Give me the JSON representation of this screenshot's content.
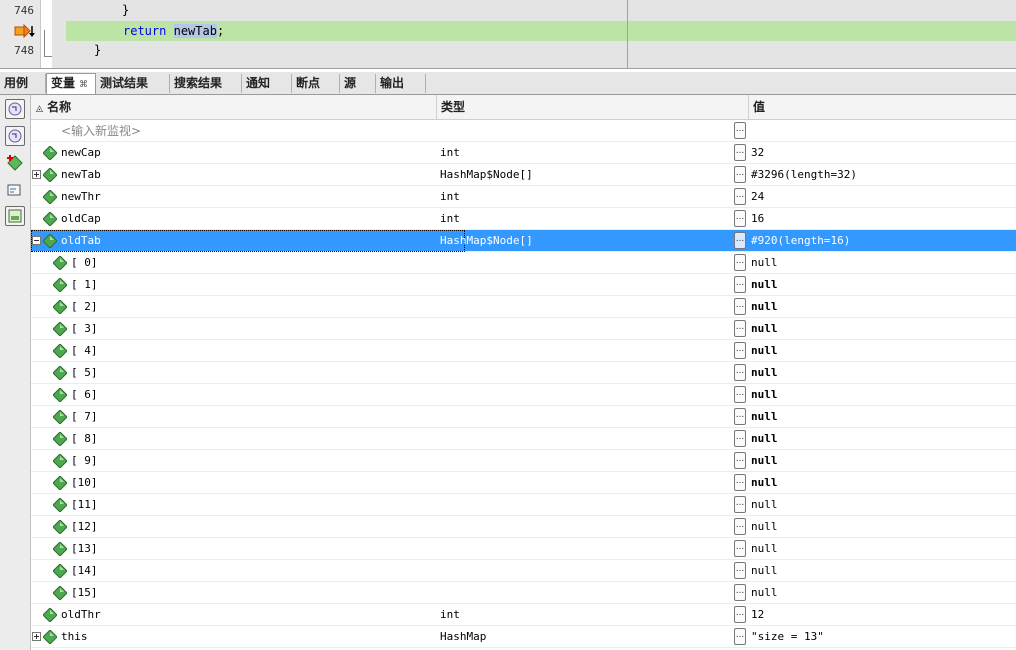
{
  "editor": {
    "lines": [
      {
        "num": "746",
        "code": "}"
      },
      {
        "num": "",
        "code_kw": "return",
        "code_ident": "newTab",
        "code_tail": ";"
      },
      {
        "num": "748",
        "code": "}"
      }
    ]
  },
  "tabs": [
    {
      "label": "用例"
    },
    {
      "label": "变量",
      "close": "⌘"
    },
    {
      "label": "测试结果"
    },
    {
      "label": "搜索结果"
    },
    {
      "label": "通知"
    },
    {
      "label": "断点"
    },
    {
      "label": "源"
    },
    {
      "label": "输出"
    }
  ],
  "table": {
    "headers": {
      "name": "名称",
      "type": "类型",
      "value": "值"
    },
    "sort_glyph": "◬",
    "watch_placeholder": "<输入新监视>",
    "ellipsis": "...",
    "rows": [
      {
        "name": "newCap",
        "type": "int",
        "value": "32"
      },
      {
        "name": "newTab",
        "type": "HashMap$Node[]",
        "value": "#3296(length=32)"
      },
      {
        "name": "newThr",
        "type": "int",
        "value": "24"
      },
      {
        "name": "oldCap",
        "type": "int",
        "value": "16"
      },
      {
        "name": "oldTab",
        "type": "HashMap$Node[]",
        "value": "#920(length=16)"
      },
      {
        "name": "[ 0]",
        "type": "",
        "value": "null"
      },
      {
        "name": "[ 1]",
        "type": "",
        "value": "null"
      },
      {
        "name": "[ 2]",
        "type": "",
        "value": "null"
      },
      {
        "name": "[ 3]",
        "type": "",
        "value": "null"
      },
      {
        "name": "[ 4]",
        "type": "",
        "value": "null"
      },
      {
        "name": "[ 5]",
        "type": "",
        "value": "null"
      },
      {
        "name": "[ 6]",
        "type": "",
        "value": "null"
      },
      {
        "name": "[ 7]",
        "type": "",
        "value": "null"
      },
      {
        "name": "[ 8]",
        "type": "",
        "value": "null"
      },
      {
        "name": "[ 9]",
        "type": "",
        "value": "null"
      },
      {
        "name": "[10]",
        "type": "",
        "value": "null"
      },
      {
        "name": "[11]",
        "type": "",
        "value": "null"
      },
      {
        "name": "[12]",
        "type": "",
        "value": "null"
      },
      {
        "name": "[13]",
        "type": "",
        "value": "null"
      },
      {
        "name": "[14]",
        "type": "",
        "value": "null"
      },
      {
        "name": "[15]",
        "type": "",
        "value": "null"
      },
      {
        "name": "oldThr",
        "type": "int",
        "value": "12"
      },
      {
        "name": "this",
        "type": "HashMap",
        "value": "\"size = 13\""
      }
    ]
  },
  "icons": {
    "variable": "green-diamond-icon",
    "current-line": "debug-arrow-icon",
    "toolbar": [
      "watch-icon",
      "watch-icon",
      "new-watch-icon",
      "expression-icon",
      "panel-icon"
    ]
  },
  "colors": {
    "selection": "#3399ff",
    "current_line": "#bde4a7",
    "gem": "#4ea84e"
  }
}
